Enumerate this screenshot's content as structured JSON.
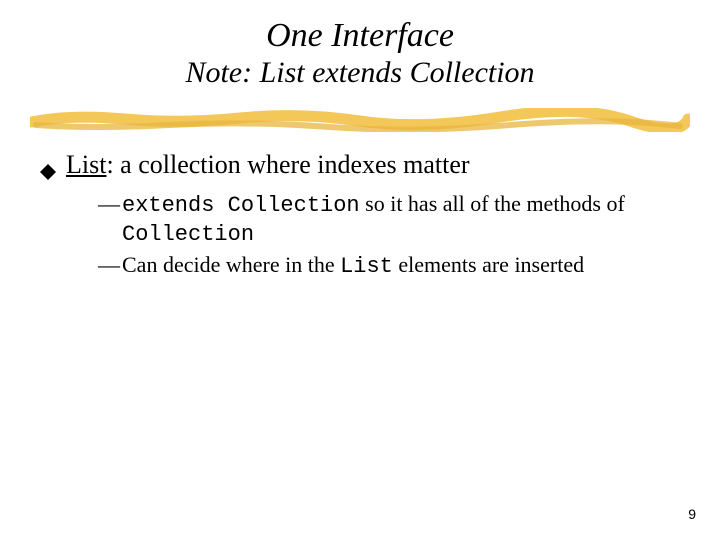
{
  "title": "One Interface",
  "subtitle": "Note: List extends Collection",
  "bullet1": {
    "term": "List",
    "rest": ": a collection where indexes matter"
  },
  "sub": [
    {
      "pre": "extends Collection",
      "mid": " so it has all of the methods of ",
      "post": "Collection"
    },
    {
      "pre2": "Can decide where in the ",
      "mono2": "List",
      "post2": " elements are inserted"
    }
  ],
  "pagenum": "9"
}
